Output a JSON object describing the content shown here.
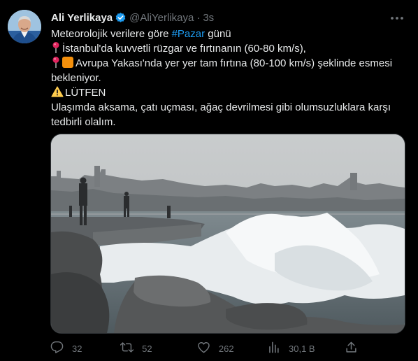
{
  "author": {
    "name": "Ali Yerlikaya",
    "handle": "@AliYerlikaya",
    "separator": "·",
    "time": "3s"
  },
  "tweet": {
    "line1_before": "Meteorolojik verilere göre ",
    "line1_hashtag": "#Pazar",
    "line1_after": " günü",
    "line2": "İstanbul'da kuvvetli rüzgar ve fırtınanın (60-80 km/s),",
    "line3": "Avrupa Yakası'nda yer yer tam fırtına (80-100 km/s) şeklinde esmesi bekleniyor.",
    "line4": "LÜTFEN",
    "line5": "Ulaşımda aksama, çatı uçması, ağaç devrilmesi gibi olumsuzluklara karşı tedbirli olalım."
  },
  "actions": {
    "replies": "32",
    "retweets": "52",
    "likes": "262",
    "views": "30,1 B"
  },
  "icons": [
    "verified-badge-icon",
    "more-icon",
    "pin-icon",
    "orange-square-icon",
    "warning-icon",
    "reply-icon",
    "retweet-icon",
    "like-icon",
    "views-icon",
    "share-icon"
  ],
  "colors": {
    "background": "#000000",
    "text": "#e7e9ea",
    "secondary": "#71767b",
    "accent": "#1d9bf0",
    "border": "#2f3336"
  }
}
